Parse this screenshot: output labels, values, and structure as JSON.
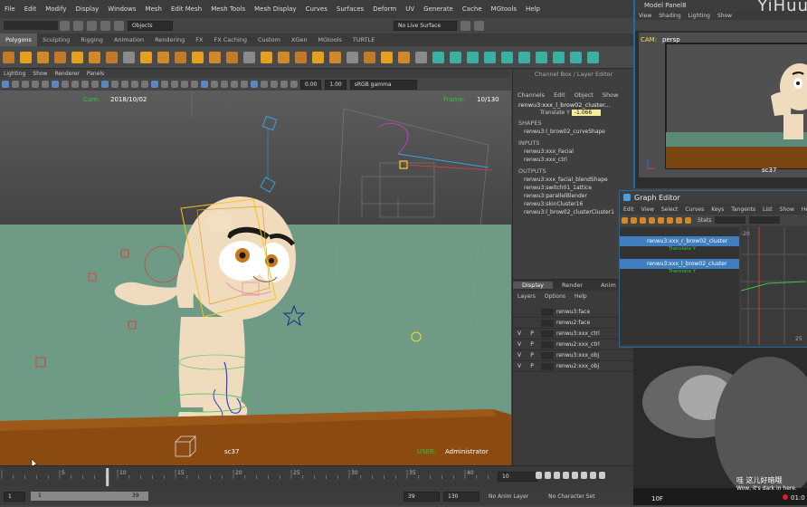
{
  "window": {
    "title": "renwu3:xxx_l_brow02_cluster..."
  },
  "menus": [
    "File",
    "Edit",
    "Modify",
    "Display",
    "Windows",
    "Mesh",
    "Edit Mesh",
    "Mesh Tools",
    "Mesh Display",
    "Curves",
    "Surfaces",
    "Deform",
    "UV",
    "Generate",
    "Cache",
    "MGtools",
    "Help"
  ],
  "statusline": {
    "objects_label": "Objects",
    "live_surface": "No Live Surface"
  },
  "shelf_tabs": [
    "Polygons",
    "Sculpting",
    "Rigging",
    "Animation",
    "Rendering",
    "FX",
    "FX Caching",
    "Custom",
    "XGen",
    "MGtools",
    "TURTLE"
  ],
  "shelf_tabs_active": 0,
  "viewport": {
    "menu": [
      "Lighting",
      "Show",
      "Renderer",
      "Panels"
    ],
    "field1": "0.00",
    "field2": "1.00",
    "colorspace": "sRGB gamma",
    "cam_label": "Cam:",
    "date": "2018/10/02",
    "frame_label": "Frame:",
    "frame": "10/130",
    "camera_name": "sc37",
    "user_label": "USER:",
    "user": "Administrator"
  },
  "channel_box": {
    "header": "Channel Box / Layer Editor",
    "menus": [
      "Channels",
      "Edit",
      "Object",
      "Show"
    ],
    "node": "renwu3:xxx_l_brow02_cluster...",
    "translate_label": "Translate Y",
    "translate_value": "-1.066",
    "shapes_label": "SHAPES",
    "shape": "renwu3:l_brow02_curveShape",
    "inputs_label": "INPUTS",
    "inputs": [
      "renwu3:xxx_Facial",
      "renwu3:xxx_ctrl"
    ],
    "outputs_label": "OUTPUTS",
    "outputs": [
      "renwu3:xxx_facial_blendShape",
      "renwu3:switch01_1attice",
      "renwu3:parallelBlender",
      "renwu3:skinCluster16",
      "renwu3:l_brow02_clusterCluster1"
    ],
    "layer_tabs": [
      "Display",
      "Render",
      "Anim"
    ],
    "layer_menus": [
      "Layers",
      "Options",
      "Help"
    ],
    "layers": [
      {
        "v": "",
        "p": "",
        "name": "renwu3:face"
      },
      {
        "v": "",
        "p": "",
        "name": "renwu2:face"
      },
      {
        "v": "V",
        "p": "P",
        "name": "renwu3:xxx_ctrl"
      },
      {
        "v": "V",
        "p": "P",
        "name": "renwu2:xxx_ctrl"
      },
      {
        "v": "V",
        "p": "P",
        "name": "renwu3:xxx_obj"
      },
      {
        "v": "V",
        "p": "P",
        "name": "renwu2:xxx_obj"
      }
    ]
  },
  "model_panel": {
    "title": "Model Panel8",
    "menus": [
      "View",
      "Shading",
      "Lighting",
      "Show"
    ],
    "cam_label": "CAM:",
    "cam": "persp",
    "shot": "sc37",
    "watermark": "YiHuu"
  },
  "graph_editor": {
    "title": "Graph Editor",
    "menus": [
      "Edit",
      "View",
      "Select",
      "Curves",
      "Keys",
      "Tangents",
      "List",
      "Show",
      "He"
    ],
    "stats_label": "Stats",
    "items": [
      {
        "name": "renwu3:xxx_r_brow02_cluster",
        "child": "Translate Y"
      },
      {
        "name": "renwu3:xxx_l_brow02_cluster",
        "child": "Translate Y"
      }
    ],
    "ruler": [
      "-20",
      "25"
    ]
  },
  "timeline": {
    "ticks": [
      "5",
      "10",
      "15",
      "20",
      "25",
      "30",
      "35",
      "40"
    ],
    "current": "10"
  },
  "range": {
    "start": "1",
    "inner_start": "1",
    "inner_end": "39",
    "end": "39",
    "total": "130",
    "anim_layer": "No Anim Layer",
    "char_set": "No Character Set"
  },
  "video": {
    "subtitle_cn": "哇 这儿好暗哦",
    "subtitle_en": "Wow, it's dark in here.",
    "time": "01:0",
    "frame": "10F"
  },
  "colors": {
    "accent": "#1e6ba8",
    "ground": "#6e9a86",
    "table": "#8b4a0f",
    "cam_green": "#36c43a",
    "highlight": "#3f7fc0"
  }
}
